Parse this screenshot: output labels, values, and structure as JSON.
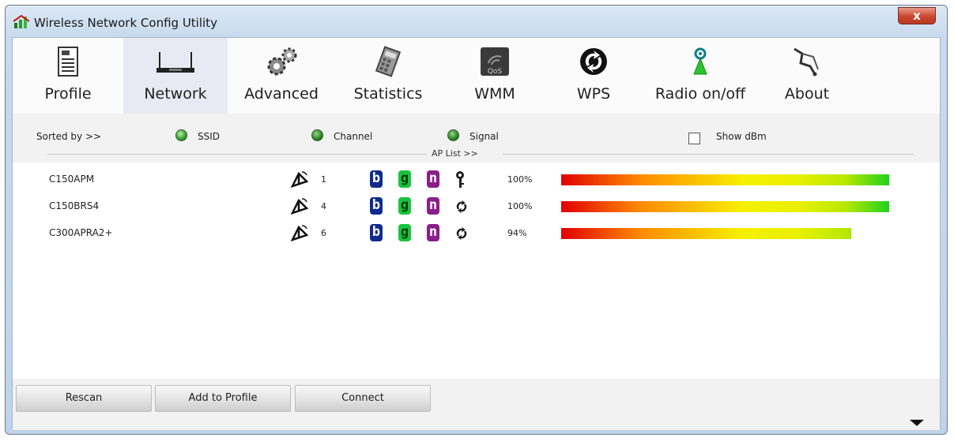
{
  "window": {
    "title": "Wireless Network Config Utility",
    "close_label": "x"
  },
  "tabs": [
    {
      "label": "Profile",
      "icon": "profile-icon"
    },
    {
      "label": "Network",
      "icon": "router-icon",
      "active": true
    },
    {
      "label": "Advanced",
      "icon": "gears-icon"
    },
    {
      "label": "Statistics",
      "icon": "statistics-icon"
    },
    {
      "label": "WMM",
      "icon": "qos-icon"
    },
    {
      "label": "WPS",
      "icon": "wps-icon"
    },
    {
      "label": "Radio on/off",
      "icon": "radio-antenna-icon"
    },
    {
      "label": "About",
      "icon": "about-icon"
    }
  ],
  "sort": {
    "label": "Sorted by >>",
    "options": [
      {
        "label": "SSID",
        "selected": true
      },
      {
        "label": "Channel",
        "selected": false
      },
      {
        "label": "Signal",
        "selected": false
      }
    ],
    "show_dbm_label": "Show dBm",
    "show_dbm_checked": false
  },
  "ap_list": {
    "header": "AP List >>",
    "rows": [
      {
        "ssid": "C150APM",
        "channel": "1",
        "modes": [
          "b",
          "g",
          "n"
        ],
        "security": "key-icon",
        "signal": "100%",
        "signal_fraction": 1.0
      },
      {
        "ssid": "C150BRS4",
        "channel": "4",
        "modes": [
          "b",
          "g",
          "n"
        ],
        "security": "wps-icon",
        "signal": "100%",
        "signal_fraction": 1.0
      },
      {
        "ssid": "C300APRA2+",
        "channel": "6",
        "modes": [
          "b",
          "g",
          "n"
        ],
        "security": "wps-icon",
        "signal": "94%",
        "signal_fraction": 0.94
      }
    ]
  },
  "buttons": {
    "rescan": "Rescan",
    "add_to_profile": "Add to Profile",
    "connect": "Connect"
  },
  "colors": {
    "title_bar": "#c8daee",
    "close_button": "#c9452f",
    "mode_b": "#0f2c8c",
    "mode_g": "#18c43c",
    "mode_n": "#8a1e8a",
    "signal_low": "#e00000",
    "signal_high": "#1fd21f"
  }
}
